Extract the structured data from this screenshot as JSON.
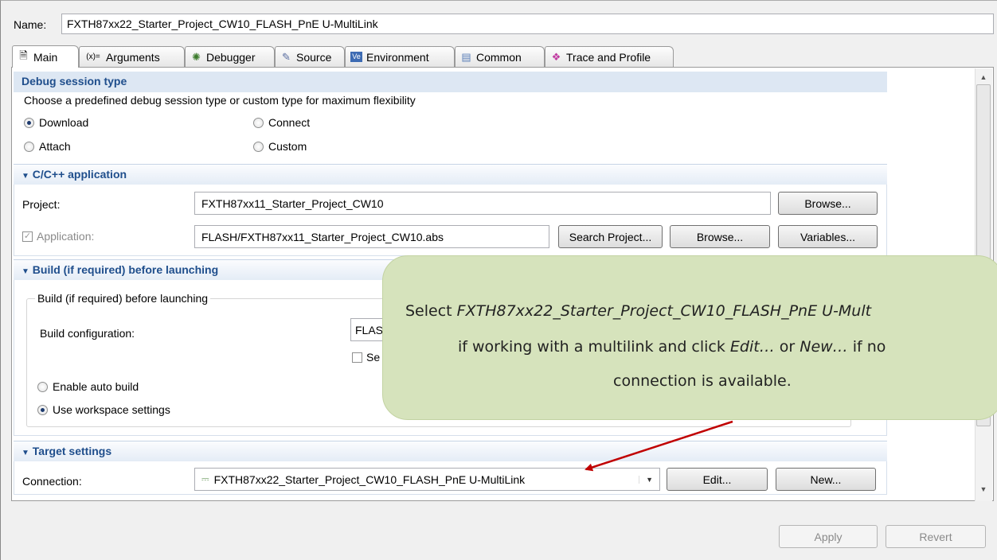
{
  "name": {
    "label": "Name:",
    "value": "FXTH87xx22_Starter_Project_CW10_FLASH_PnE U-MultiLink"
  },
  "tabs": [
    {
      "label": "Main",
      "icon": "main-icon",
      "selected": true
    },
    {
      "label": "Arguments",
      "icon": "arguments-icon"
    },
    {
      "label": "Debugger",
      "icon": "debugger-icon"
    },
    {
      "label": "Source",
      "icon": "source-icon"
    },
    {
      "label": "Environment",
      "icon": "environment-icon"
    },
    {
      "label": "Common",
      "icon": "common-icon"
    },
    {
      "label": "Trace and Profile",
      "icon": "trace-profile-icon"
    }
  ],
  "debug_session": {
    "title": "Debug session type",
    "description": "Choose a predefined debug session type or custom type for maximum flexibility",
    "options": [
      "Download",
      "Connect",
      "Attach",
      "Custom"
    ],
    "selected": "Download"
  },
  "cpp_app": {
    "title": "C/C++ application",
    "project_label": "Project:",
    "project_value": "FXTH87xx11_Starter_Project_CW10",
    "browse_label": "Browse...",
    "application_label": "Application:",
    "application_value": "FLASH/FXTH87xx11_Starter_Project_CW10.abs",
    "search_project_label": "Search Project...",
    "browse2_label": "Browse...",
    "variables_label": "Variables..."
  },
  "build": {
    "title": "Build (if required) before launching",
    "group_label": "Build (if required) before launching",
    "config_label": "Build configuration:",
    "config_value": "FLAS",
    "select_checkbox_label": "Se",
    "enable_auto_build": "Enable auto build",
    "use_workspace": "Use workspace settings",
    "selected": "Use workspace settings"
  },
  "target": {
    "title": "Target settings",
    "connection_label": "Connection:",
    "connection_value": "FXTH87xx22_Starter_Project_CW10_FLASH_PnE U-MultiLink",
    "edit_label": "Edit...",
    "new_label": "New..."
  },
  "footer": {
    "apply_label": "Apply",
    "revert_label": "Revert"
  },
  "callout": {
    "l1_prefix": "Select ",
    "l1_italic": "FXTH87xx22_Starter_Project_CW10_FLASH_PnE U-Mult",
    "l2_prefix": "if working with a multilink and click ",
    "l2_edit": "Edit…",
    "l2_or": " or ",
    "l2_new": "New…",
    "l2_suffix": " if no",
    "l3": "connection is available."
  },
  "colors": {
    "section_title": "#1f4e8c",
    "callout_bg": "#d6e3bc",
    "arrow": "#c00000"
  }
}
